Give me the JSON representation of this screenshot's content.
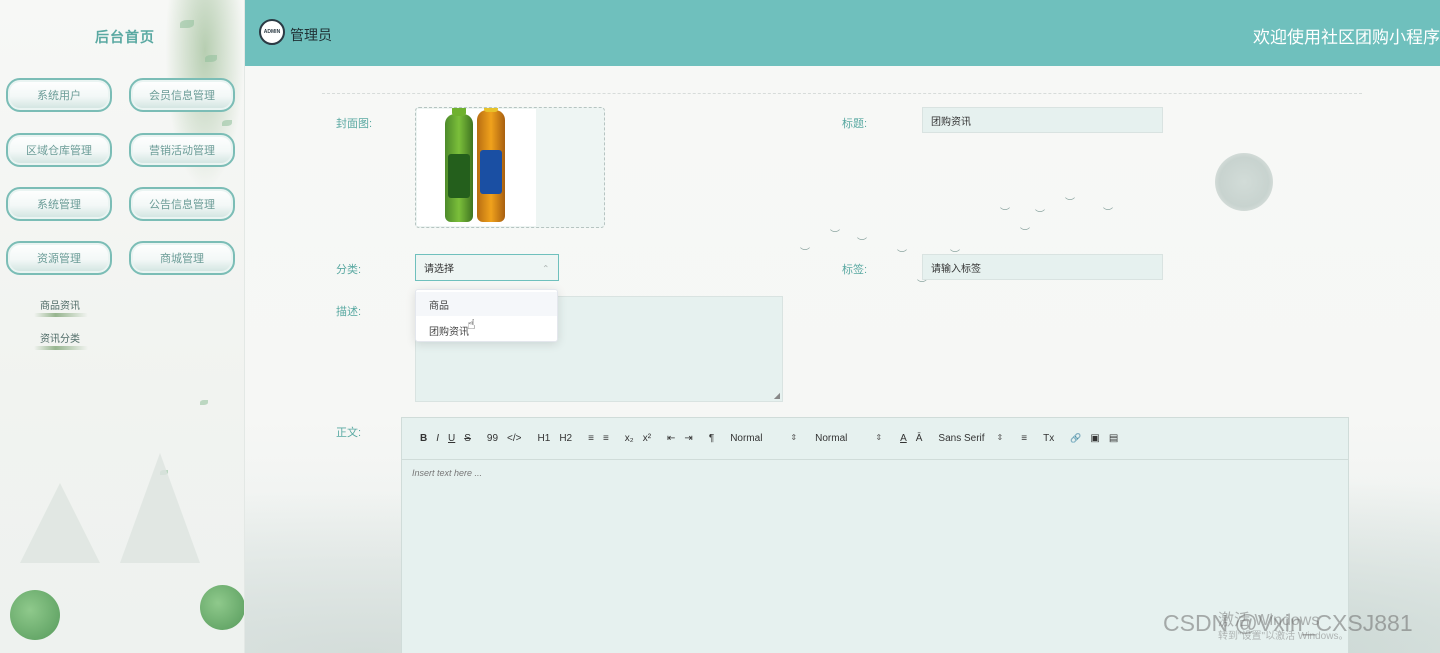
{
  "sidebar": {
    "home_title": "后台首页",
    "menu": [
      {
        "label": "系统用户"
      },
      {
        "label": "会员信息管理"
      },
      {
        "label": "区域仓库管理"
      },
      {
        "label": "营销活动管理"
      },
      {
        "label": "系统管理"
      },
      {
        "label": "公告信息管理"
      },
      {
        "label": "资源管理"
      },
      {
        "label": "商城管理"
      }
    ],
    "sub_items": [
      {
        "label": "商品资讯"
      },
      {
        "label": "资讯分类"
      }
    ]
  },
  "header": {
    "admin_label": "管理员",
    "avatar_text": "ADMIN",
    "welcome": "欢迎使用社区团购小程序"
  },
  "form": {
    "cover_label": "封面图:",
    "title_label": "标题:",
    "title_value": "团购资讯",
    "category_label": "分类:",
    "category_placeholder": "请选择",
    "category_options": [
      {
        "label": "商品"
      },
      {
        "label": "团购资讯"
      }
    ],
    "tags_label": "标签:",
    "tags_placeholder": "请输入标签",
    "description_label": "描述:",
    "body_label": "正文:",
    "editor_placeholder": "Insert text here ..."
  },
  "editor_toolbar": {
    "bold": "B",
    "italic": "I",
    "underline": "U",
    "strike": "S",
    "quote": "99",
    "code": "</>",
    "h1": "H1",
    "h2": "H2",
    "ordered_list": "≡",
    "bullet_list": "≡",
    "sub": "x₂",
    "sup": "x²",
    "outdent": "⇤",
    "indent": "⇥",
    "direction": "¶",
    "size_select": "Normal",
    "header_select": "Normal",
    "font_color": "A",
    "background": "Ā",
    "font_select": "Sans Serif",
    "align": "≡",
    "clean": "Tx",
    "link": "🔗",
    "image": "▣",
    "video": "▤"
  },
  "watermark": {
    "activate": "激活 Windows",
    "hint": "转到\"设置\"以激活 Windows。",
    "csdn": "CSDN @Vxin_CXSJ881"
  },
  "colors": {
    "header_bg": "#6fc0bd",
    "accent": "#5aa9a2",
    "field_bg": "#e6f1ef"
  }
}
